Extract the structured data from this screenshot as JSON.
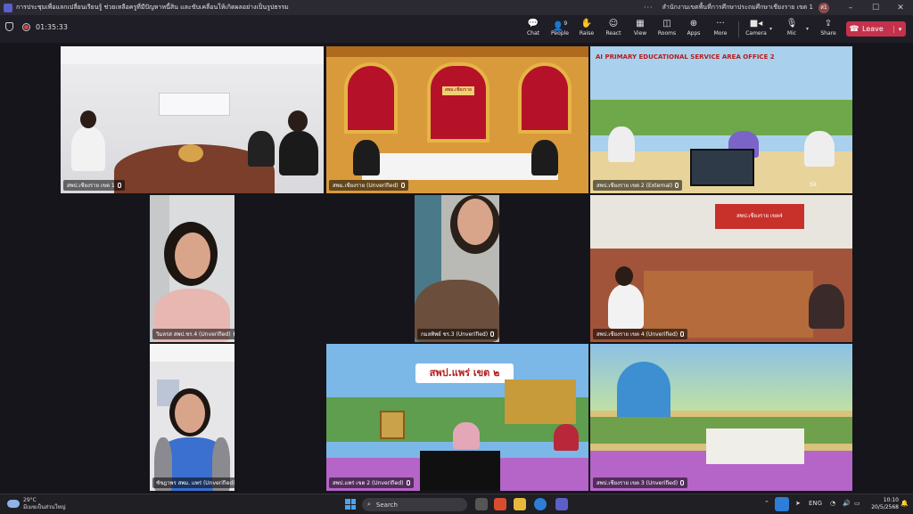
{
  "titlebar": {
    "title": "การประชุมเพื่อแลกเปลี่ยนเรียนรู้ ช่วยเหลือครูที่มีปัญหาหนี้สิน และขับเคลื่อนให้เกิดผลอย่างเป็นรูปธรรม",
    "more": "···",
    "org": "สำนักงานเขตพื้นที่การศึกษาประถมศึกษาเชียงราย เขต 1",
    "avatar": "ส1",
    "minimize": "–",
    "maximize": "☐",
    "close": "✕"
  },
  "toolbar": {
    "timer": "01:35:33",
    "buttons": [
      {
        "label": "Chat",
        "icon": "chat-icon"
      },
      {
        "label": "People",
        "icon": "people-icon",
        "badge": "9"
      },
      {
        "label": "Raise",
        "icon": "hand-icon"
      },
      {
        "label": "React",
        "icon": "smile-icon"
      },
      {
        "label": "View",
        "icon": "grid-icon"
      },
      {
        "label": "Rooms",
        "icon": "rooms-icon"
      },
      {
        "label": "Apps",
        "icon": "apps-icon"
      },
      {
        "label": "More",
        "icon": "more-icon"
      },
      {
        "label": "Camera",
        "icon": "camera-icon"
      },
      {
        "label": "Mic",
        "icon": "mic-icon"
      },
      {
        "label": "Share",
        "icon": "share-icon"
      }
    ],
    "leave_label": "Leave",
    "accent_leave": "#c4314b"
  },
  "participants": [
    {
      "name": "สพป.เชียงราย เขต 1"
    },
    {
      "name": "สพม.เชียงราย (Unverified)"
    },
    {
      "name": "สพป.เชียงราย เขต 2 (External)"
    },
    {
      "name": "วิมลรส สพป.ชร.4 (Unverified)"
    },
    {
      "name": "กมลทิพย์ ชร.3 (Unverified)"
    },
    {
      "name": "สพป.เชียงราย เขต 4 (Unverified)"
    },
    {
      "name": "ชัชฎาพร สพม. แพร่ (Unverified)"
    },
    {
      "name": "สพป.แพร่ เขต 2 (Unverified)"
    },
    {
      "name": "สพป.เชียงราย เขต 3 (Unverified)"
    }
  ],
  "tile_text": {
    "banner_cr2": "AI PRIMARY EDUCATIONAL SERVICE AREA OFFICE 2",
    "sign_cr4": "สพป.เชียงราย เขต4",
    "sign_phrae": "สพป.แพร่ เขต ๒",
    "sign_cr_school": "สพม.เชียงราย",
    "sx": "SX"
  },
  "taskbar": {
    "temp": "29°C",
    "weather": "มีเมฆเป็นส่วนใหญ่",
    "search": "Search",
    "lang": "ENG",
    "time": "10:10",
    "date": "20/5/2568"
  }
}
